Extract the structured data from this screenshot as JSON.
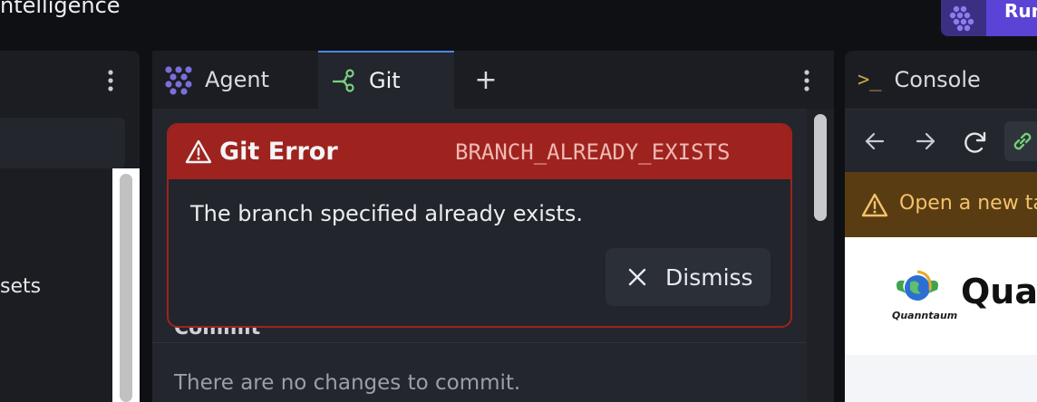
{
  "app": {
    "title": "ntelligence",
    "run_label": "Run"
  },
  "left_panel": {
    "item_label": "sets"
  },
  "tabs": [
    {
      "label": "Agent"
    },
    {
      "label": "Git"
    },
    {
      "label": "+"
    }
  ],
  "git": {
    "commit_heading": "Commit",
    "commit_empty": "There are no changes to commit."
  },
  "error": {
    "title": "Git Error",
    "code": "BRANCH_ALREADY_EXISTS",
    "message": "The branch specified already exists.",
    "dismiss_label": "Dismiss"
  },
  "console": {
    "tab_label": "Console",
    "banner_text": "Open a new tab",
    "site_name": "Quanntaum",
    "site_logo_text": "Quanntaum"
  },
  "colors": {
    "accent": "#5b43d6",
    "error": "#9e231e",
    "active_tab": "#4b86e8",
    "banner": "#5a3c12"
  },
  "icons": [
    "agent-icon",
    "git-branch-icon",
    "kebab-icon",
    "warning-icon",
    "close-icon",
    "terminal-icon",
    "back-icon",
    "forward-icon",
    "reload-icon",
    "link-icon"
  ]
}
